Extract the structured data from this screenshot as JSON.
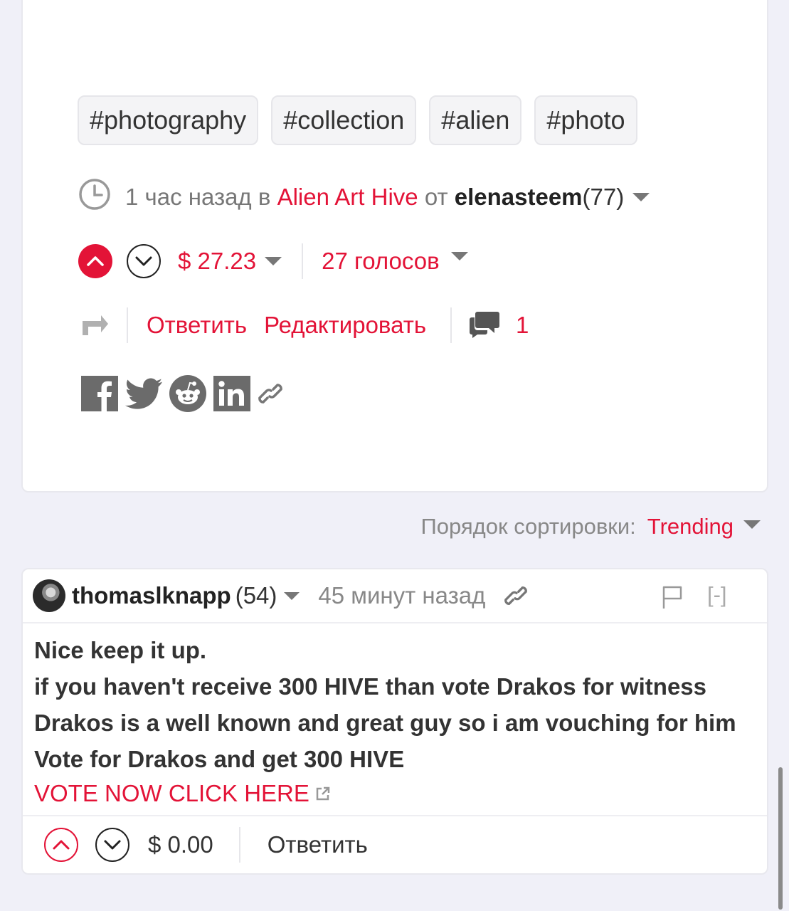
{
  "post": {
    "tags": [
      "#photography",
      "#collection",
      "#alien",
      "#photo"
    ],
    "meta": {
      "time": "1 час назад",
      "in_word": "в",
      "community": "Alien Art Hive",
      "by_word": "от",
      "author": "elenasteem",
      "reputation": "(77)"
    },
    "voting": {
      "payout": "$ 27.23",
      "votes": "27 голосов"
    },
    "actions": {
      "reply": "Ответить",
      "edit": "Редактировать",
      "comments": "1"
    }
  },
  "sort": {
    "label": "Порядок сортировки:",
    "value": "Trending"
  },
  "comment": {
    "author": "thomaslknapp",
    "reputation": "(54)",
    "time": "45 минут назад",
    "collapse": "[-]",
    "lines": [
      "Nice keep it up.",
      "if you haven't receive 300 HIVE than vote Drakos for witness",
      "Drakos is a well known and great guy so i am vouching for him",
      "Vote for Drakos and get 300 HIVE"
    ],
    "link_text": "VOTE NOW CLICK HERE",
    "payout": "$ 0.00",
    "reply": "Ответить"
  },
  "colors": {
    "accent": "#e31337",
    "background": "#f0f0f8",
    "card": "#ffffff"
  }
}
